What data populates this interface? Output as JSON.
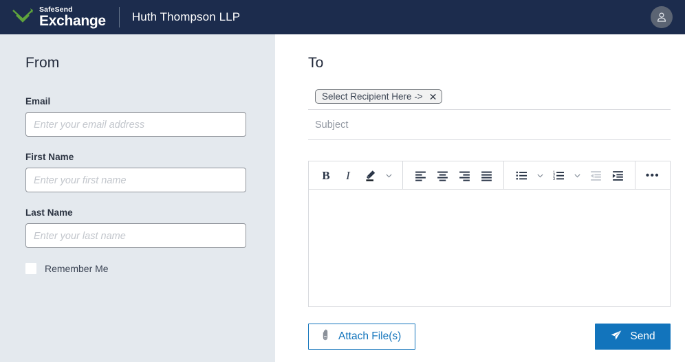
{
  "header": {
    "brand_top": "SafeSend",
    "brand_bottom": "Exchange",
    "company": "Huth Thompson LLP",
    "logo_icon": "safesend-chevron-logo",
    "avatar_icon": "user-avatar-icon"
  },
  "from_panel": {
    "title": "From",
    "fields": [
      {
        "label": "Email",
        "placeholder": "Enter your email address",
        "value": ""
      },
      {
        "label": "First Name",
        "placeholder": "Enter your first name",
        "value": ""
      },
      {
        "label": "Last Name",
        "placeholder": "Enter your last name",
        "value": ""
      }
    ],
    "remember_me": {
      "label": "Remember Me",
      "checked": false
    }
  },
  "to_panel": {
    "title": "To",
    "recipient_chip": {
      "label": "Select Recipient Here ->",
      "close_icon": "close-icon",
      "close_glyph": "✕"
    },
    "subject": {
      "placeholder": "Subject",
      "value": ""
    },
    "editor": {
      "body_value": "",
      "toolbar": [
        {
          "name": "bold-button",
          "icon": "bold-icon",
          "glyph": "B",
          "disabled": false
        },
        {
          "name": "italic-button",
          "icon": "italic-icon",
          "glyph": "I",
          "disabled": false
        },
        {
          "name": "text-highlight-button",
          "icon": "highlighter-icon",
          "disabled": false
        },
        {
          "name": "text-highlight-dropdown",
          "icon": "chevron-down-icon",
          "disabled": false
        },
        {
          "name": "align-left-button",
          "icon": "align-left-icon",
          "disabled": false
        },
        {
          "name": "align-center-button",
          "icon": "align-center-icon",
          "disabled": false
        },
        {
          "name": "align-right-button",
          "icon": "align-right-icon",
          "disabled": false
        },
        {
          "name": "align-justify-button",
          "icon": "align-justify-icon",
          "disabled": false
        },
        {
          "name": "bulleted-list-button",
          "icon": "bulleted-list-icon",
          "disabled": false
        },
        {
          "name": "bulleted-list-dropdown",
          "icon": "chevron-down-icon",
          "disabled": false
        },
        {
          "name": "numbered-list-button",
          "icon": "numbered-list-icon",
          "disabled": false
        },
        {
          "name": "numbered-list-dropdown",
          "icon": "chevron-down-icon",
          "disabled": false
        },
        {
          "name": "decrease-indent-button",
          "icon": "outdent-icon",
          "disabled": true
        },
        {
          "name": "increase-indent-button",
          "icon": "indent-icon",
          "disabled": false
        },
        {
          "name": "more-options-button",
          "icon": "ellipsis-icon",
          "glyph": "•••",
          "disabled": false
        }
      ]
    },
    "attach_button": {
      "label": "Attach File(s)",
      "icon": "paperclip-icon"
    },
    "send_button": {
      "label": "Send",
      "icon": "paper-plane-icon"
    }
  },
  "colors": {
    "header_bg": "#1c2c4d",
    "sidebar_bg": "#e4e9ee",
    "accent_blue": "#1274bc",
    "logo_green": "#5fa43c",
    "border_gray": "#d8dade"
  }
}
